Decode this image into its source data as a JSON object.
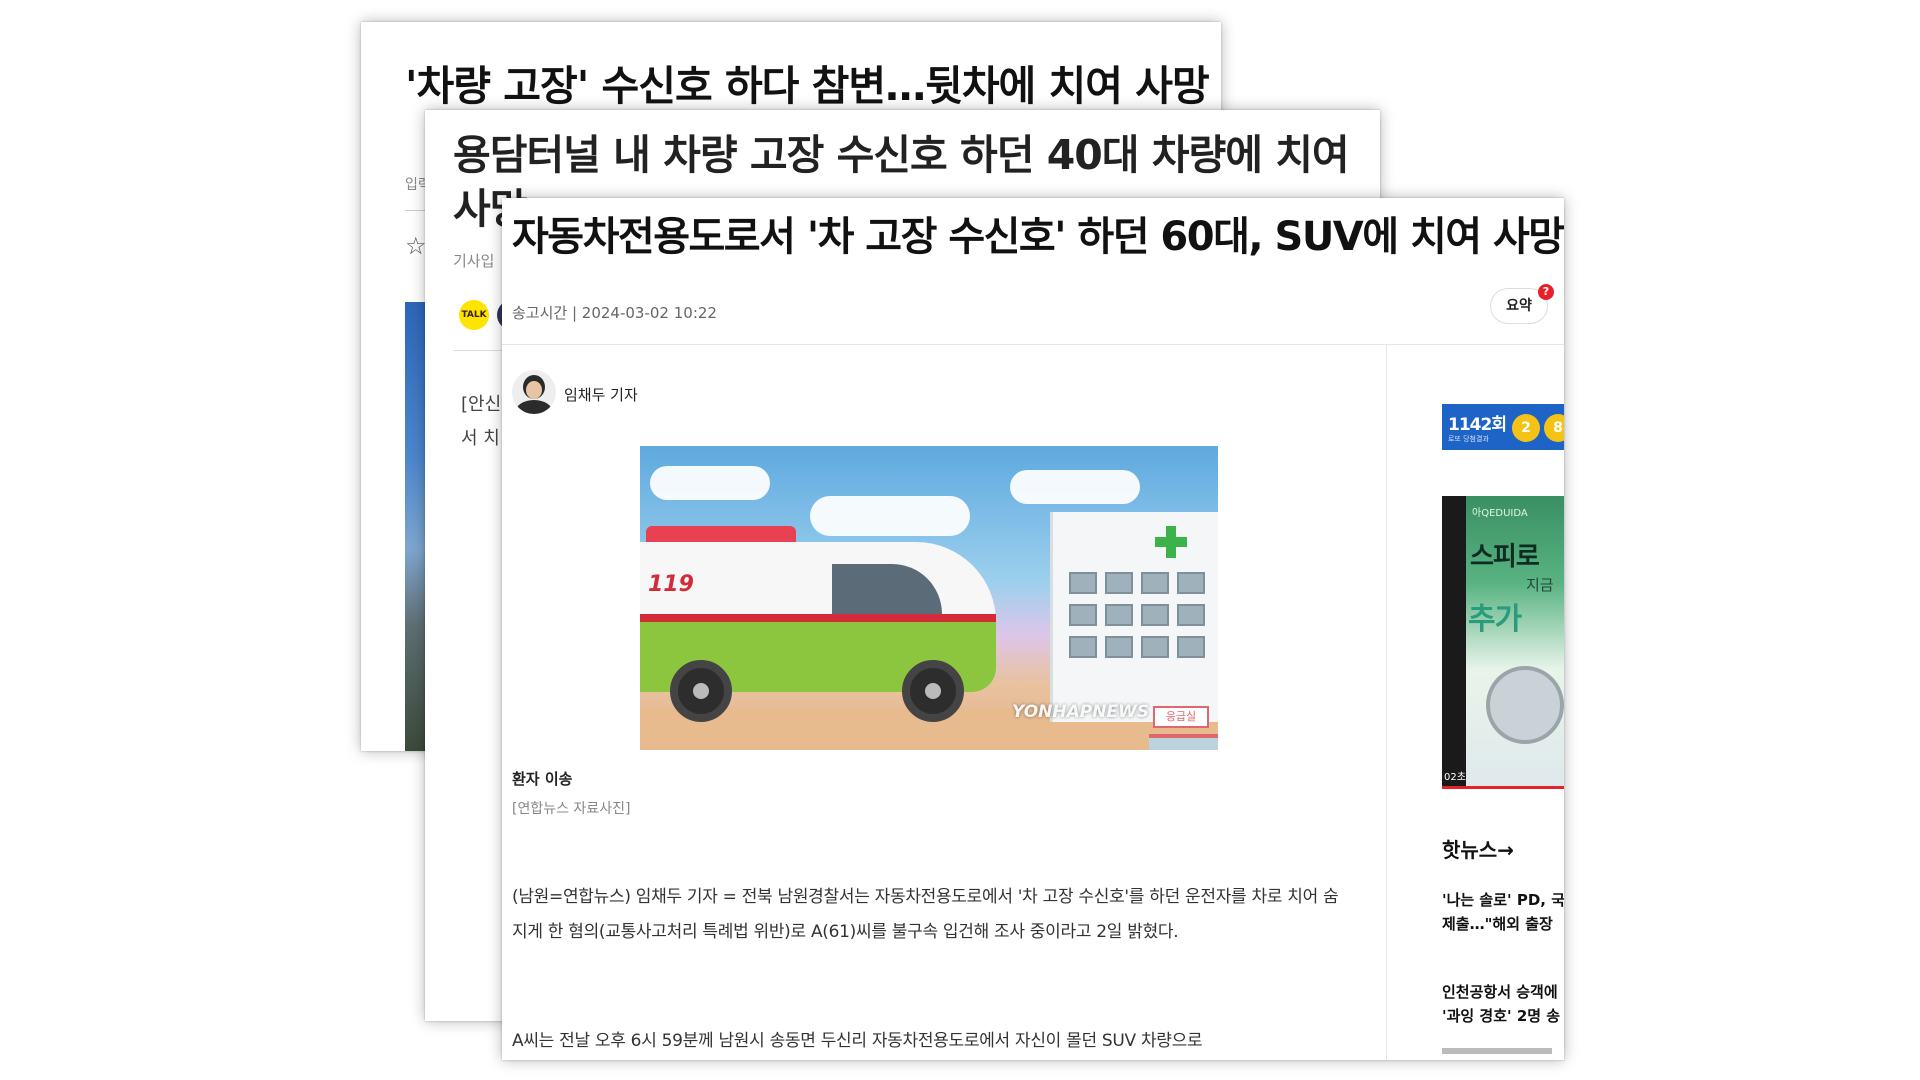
{
  "articles": {
    "back": {
      "headline": "'차량 고장' 수신호 하다 참변…뒷차에 치여 사망",
      "meta_label": "입력"
    },
    "middle": {
      "headline": "용담터널 내 차량 고장 수신호 하던 40대 차량에 치여 사망",
      "meta_label": "기사입",
      "kakao_label": "TALK",
      "body_fragment_1": "[안신",
      "body_fragment_2": "서 치"
    },
    "front": {
      "headline": "자동차전용도로서 '차 고장 수신호' 하던 60대, SUV에 치여 사망",
      "send_time": "송고시간 | 2024-03-02 10:22",
      "summary_button": "요약",
      "summary_badge": "?",
      "author": "임채두 기자",
      "image_watermark": "YONHAPNEWS",
      "image_logo": "119",
      "image_er_sign": "응급실",
      "caption_title": "환자 이송",
      "caption_credit": "[연합뉴스 자료사진]",
      "paragraph_1": "(남원=연합뉴스) 임채두 기자 = 전북 남원경찰서는 자동차전용도로에서 '차 고장 수신호'를 하던 운전자를 차로 치어 숨지게 한 혐의(교통사고처리 특례법 위반)로 A(61)씨를 불구속 입건해 조사 중이라고 2일 밝혔다.",
      "paragraph_2": "A씨는 전날 오후 6시 59분께 남원시 송동면 두신리 자동차전용도로에서 자신이 몰던 SUV 차량으로"
    }
  },
  "sidebar": {
    "lotto_round": "1142회",
    "lotto_sub": "로또 당첨결과",
    "lotto_balls": [
      "2",
      "8"
    ],
    "ad_brand": "아QEDUIDA",
    "ad_title": "스피로",
    "ad_sub": "지금",
    "ad_big": "추가",
    "ad_timer": "02초",
    "hot_news_title": "핫뉴스→",
    "hot_news": [
      {
        "line1": "'나는 솔로' PD, 국",
        "line2": "제출…\"해외 출장"
      },
      {
        "line1": "인천공항서 승객에",
        "line2": "'과잉 경호' 2명 송"
      }
    ]
  },
  "colors": {
    "lotto_blue": "#1e63c6",
    "lotto_ball": "#f5c316",
    "badge_red": "#e8202a",
    "ambulance_green": "#8cc63f",
    "kakao_yellow": "#fde500"
  }
}
